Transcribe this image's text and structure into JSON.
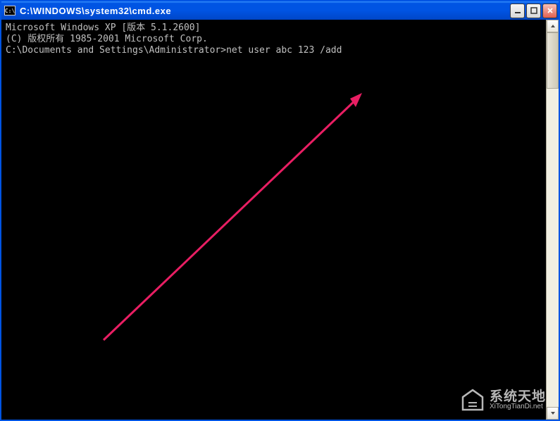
{
  "titlebar": {
    "icon_label": "C:\\",
    "title": "C:\\WINDOWS\\system32\\cmd.exe"
  },
  "window_controls": {
    "minimize": "minimize",
    "maximize": "maximize",
    "close": "close"
  },
  "terminal": {
    "line1": "Microsoft Windows XP [版本 5.1.2600]",
    "line2": "(C) 版权所有 1985-2001 Microsoft Corp.",
    "line3": "",
    "prompt": "C:\\Documents and Settings\\Administrator>",
    "command": "net user abc 123 /add"
  },
  "watermark": {
    "name_cn": "系统天地",
    "name_en": "XiTongTianDi.net"
  }
}
